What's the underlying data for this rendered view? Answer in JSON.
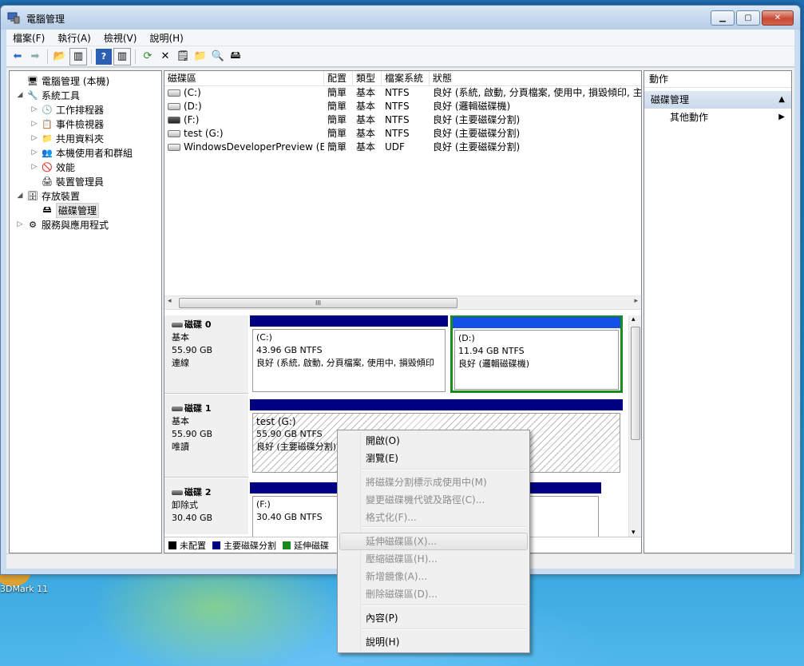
{
  "window": {
    "title": "電腦管理"
  },
  "menu": [
    "檔案(F)",
    "執行(A)",
    "檢視(V)",
    "說明(H)"
  ],
  "tree": [
    {
      "label": "電腦管理 (本機)",
      "icon": "computer-icon",
      "glyph": "🖥",
      "expander": ""
    },
    {
      "label": "系統工具",
      "icon": "tools-icon",
      "glyph": "🔧",
      "expander": "◢"
    },
    {
      "label": "工作排程器",
      "icon": "clock-icon",
      "glyph": "🕓",
      "expander": "▷"
    },
    {
      "label": "事件檢視器",
      "icon": "event-viewer-icon",
      "glyph": "📋",
      "expander": "▷"
    },
    {
      "label": "共用資料夾",
      "icon": "shared-folder-icon",
      "glyph": "📁",
      "expander": "▷"
    },
    {
      "label": "本機使用者和群組",
      "icon": "users-icon",
      "glyph": "👥",
      "expander": "▷"
    },
    {
      "label": "效能",
      "icon": "performance-icon",
      "glyph": "🚫",
      "expander": "▷"
    },
    {
      "label": "裝置管理員",
      "icon": "device-manager-icon",
      "glyph": "🖨",
      "expander": ""
    },
    {
      "label": "存放裝置",
      "icon": "storage-icon",
      "glyph": "🗄",
      "expander": "◢"
    },
    {
      "label": "磁碟管理",
      "icon": "disk-management-icon",
      "glyph": "🖴",
      "expander": ""
    },
    {
      "label": "服務與應用程式",
      "icon": "services-icon",
      "glyph": "⚙",
      "expander": "▷"
    }
  ],
  "volume_list": {
    "headers": [
      "磁碟區",
      "配置",
      "類型",
      "檔案系統",
      "狀態"
    ],
    "rows": [
      {
        "volume": "(C:)",
        "layout": "簡單",
        "type": "基本",
        "fs": "NTFS",
        "status": "良好 (系統, 啟動, 分頁檔案, 使用中, 損毀傾印, 主要"
      },
      {
        "volume": "(D:)",
        "layout": "簡單",
        "type": "基本",
        "fs": "NTFS",
        "status": "良好 (邏輯磁碟機)"
      },
      {
        "volume": "(F:)",
        "layout": "簡單",
        "type": "基本",
        "fs": "NTFS",
        "status": "良好 (主要磁碟分割)"
      },
      {
        "volume": "test (G:)",
        "layout": "簡單",
        "type": "基本",
        "fs": "NTFS",
        "status": "良好 (主要磁碟分割)"
      },
      {
        "volume": "WindowsDeveloperPreview (E:)",
        "layout": "簡單",
        "type": "基本",
        "fs": "UDF",
        "status": "良好 (主要磁碟分割)"
      }
    ],
    "scroll_thumb_text": "III"
  },
  "disks": [
    {
      "name": "磁碟 0",
      "type": "基本",
      "size": "55.90 GB",
      "state": "連線",
      "partitions": [
        {
          "name": "(C:)",
          "size": "43.96 GB NTFS",
          "status": "良好 (系統, 啟動, 分頁檔案, 使用中, 損毀傾印"
        },
        {
          "name": "(D:)",
          "size": "11.94 GB NTFS",
          "status": "良好 (邏輯磁碟機)"
        }
      ]
    },
    {
      "name": "磁碟 1",
      "type": "基本",
      "size": "55.90 GB",
      "state": "唯讀",
      "partitions": [
        {
          "name": "test  (G:)",
          "size": "55.90 GB NTFS",
          "status": "良好 (主要磁碟分割)"
        }
      ]
    },
    {
      "name": "磁碟 2",
      "type": "卸除式",
      "size": "30.40 GB",
      "state": "",
      "partitions": [
        {
          "name": "(F:)",
          "size": "30.40 GB NTFS",
          "status": ""
        }
      ]
    }
  ],
  "legend": [
    {
      "label": "未配置",
      "color": "#000000"
    },
    {
      "label": "主要磁碟分割",
      "color": "#000080"
    },
    {
      "label": "延伸磁碟",
      "color": "#1a8a1a"
    }
  ],
  "actions": {
    "header": "動作",
    "section": "磁碟管理",
    "more": "其他動作"
  },
  "context_menu": [
    {
      "label": "開啟(O)",
      "disabled": false
    },
    {
      "label": "瀏覽(E)",
      "disabled": false
    },
    {
      "label": "將磁碟分割標示成使用中(M)",
      "disabled": true
    },
    {
      "label": "變更磁碟機代號及路徑(C)...",
      "disabled": true
    },
    {
      "label": "格式化(F)...",
      "disabled": true
    },
    {
      "label": "延伸磁碟區(X)...",
      "disabled": true
    },
    {
      "label": "壓縮磁碟區(H)...",
      "disabled": true
    },
    {
      "label": "新增鏡像(A)...",
      "disabled": true
    },
    {
      "label": "刪除磁碟區(D)...",
      "disabled": true
    },
    {
      "label": "內容(P)",
      "disabled": false
    },
    {
      "label": "說明(H)",
      "disabled": false
    }
  ],
  "desktop": {
    "icon_label": "3DMark 11"
  }
}
